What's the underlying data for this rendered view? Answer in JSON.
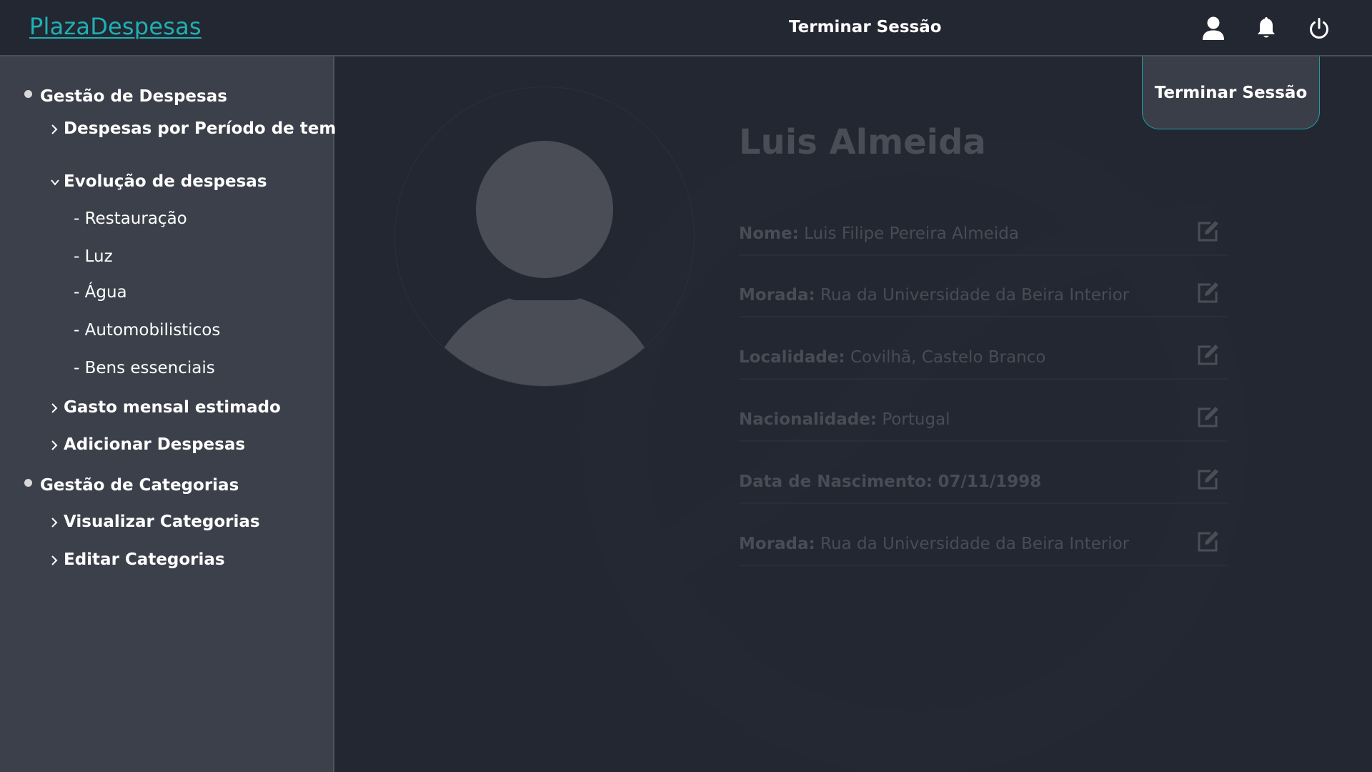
{
  "header": {
    "brand": "PlazaDespesas",
    "center_label": "Terminar Sessão",
    "icons": [
      "user-icon",
      "bell-icon",
      "power-icon"
    ]
  },
  "sidebar": {
    "sections": [
      {
        "label": "Gestão de Despesas",
        "items": [
          {
            "label": "Despesas por Período de tempo",
            "expanded": false
          },
          {
            "label": "Evolução de despesas",
            "expanded": true,
            "children": [
              "- Restauração",
              "- Luz",
              "- Água",
              "- Automobilisticos",
              "- Bens essenciais"
            ]
          },
          {
            "label": "Gasto mensal estimado",
            "expanded": false
          },
          {
            "label": "Adicionar Despesas",
            "expanded": false
          }
        ]
      },
      {
        "label": "Gestão de Categorias",
        "items": [
          {
            "label": "Visualizar Categorias",
            "expanded": false
          },
          {
            "label": "Editar Categorias",
            "expanded": false
          }
        ]
      }
    ]
  },
  "profile": {
    "name": "Luis Almeida",
    "fields": [
      {
        "label": "Nome:",
        "value": "Luis Filipe Pereira Almeida"
      },
      {
        "label": "Morada:",
        "value": "Rua da Universidade da Beira Interior"
      },
      {
        "label": "Localidade:",
        "value": "Covilhã, Castelo Branco"
      },
      {
        "label": "Nacionalidade:",
        "value": "Portugal"
      },
      {
        "label": "Data de Nascimento:",
        "value": "07/11/1998"
      },
      {
        "label": "Morada:",
        "value": "Rua da Universidade da Beira Interior"
      }
    ]
  },
  "dropdown": {
    "label": "Terminar Sessão"
  },
  "colors": {
    "accent": "#1fb0b4",
    "background": "#232731",
    "sidebar": "#3c404a",
    "muted_text": "#494c54"
  }
}
